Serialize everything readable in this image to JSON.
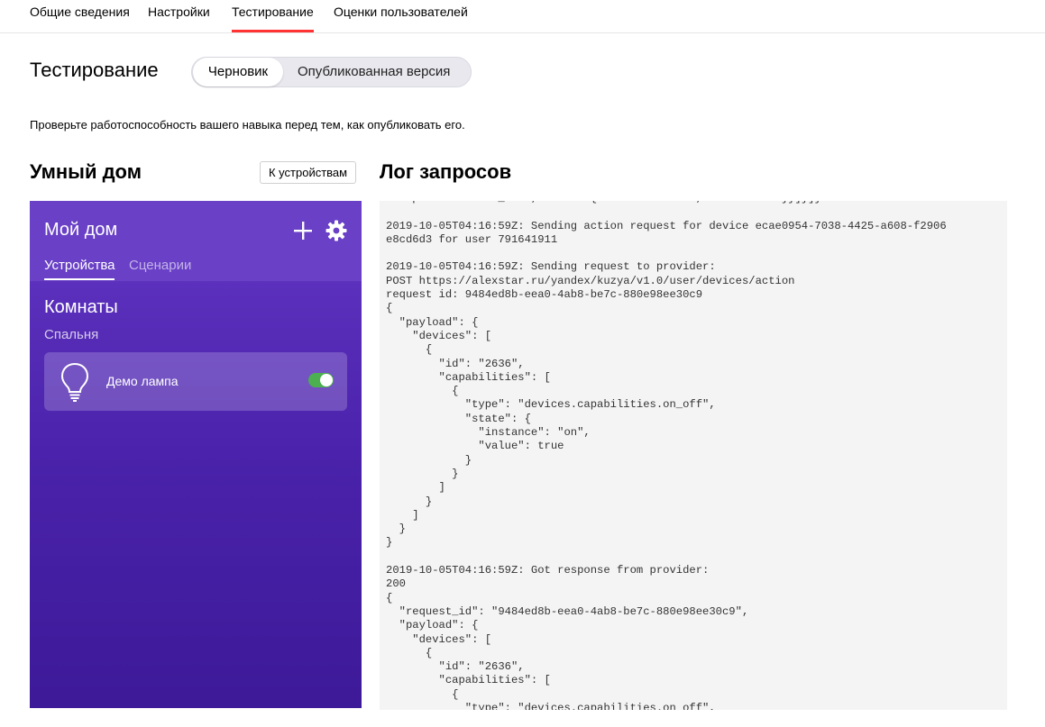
{
  "top_tabs": [
    {
      "label": "Общие сведения"
    },
    {
      "label": "Настройки"
    },
    {
      "label": "Тестирование"
    },
    {
      "label": "Оценки пользователей"
    }
  ],
  "page": {
    "title": "Тестирование",
    "segmented": {
      "draft": "Черновик",
      "published": "Опубликованная версия"
    },
    "description": "Проверьте работоспособность вашего навыка перед тем, как опубликовать его."
  },
  "smart_home": {
    "title": "Умный дом",
    "to_devices_button": "К устройствам",
    "phone": {
      "home_title": "Мой дом",
      "tabs": {
        "devices": "Устройства",
        "scenarios": "Сценарии"
      },
      "rooms_title": "Комнаты",
      "room_name": "Спальня",
      "device": {
        "name": "Демо лампа",
        "state": "on"
      }
    }
  },
  "log": {
    "title": "Лог запросов",
    "text": "s:capabilities.on_off\",\"state\":{\"instance\":\"on\",\"value\":true}}]}]}\n\n2019-10-05T04:16:59Z: Sending action request for device ecae0954-7038-4425-a608-f2906\ne8cd6d3 for user 791641911\n\n2019-10-05T04:16:59Z: Sending request to provider:\nPOST https://alexstar.ru/yandex/kuzya/v1.0/user/devices/action\nrequest id: 9484ed8b-eea0-4ab8-be7c-880e98ee30c9\n{\n  \"payload\": {\n    \"devices\": [\n      {\n        \"id\": \"2636\",\n        \"capabilities\": [\n          {\n            \"type\": \"devices.capabilities.on_off\",\n            \"state\": {\n              \"instance\": \"on\",\n              \"value\": true\n            }\n          }\n        ]\n      }\n    ]\n  }\n}\n\n2019-10-05T04:16:59Z: Got response from provider:\n200\n{\n  \"request_id\": \"9484ed8b-eea0-4ab8-be7c-880e98ee30c9\",\n  \"payload\": {\n    \"devices\": [\n      {\n        \"id\": \"2636\",\n        \"capabilities\": [\n          {\n            \"type\": \"devices.capabilities.on_off\","
  },
  "colors": {
    "accent_red": "#ff3333",
    "phone_purple": "#5a2fbb",
    "toggle_green": "#4caf50"
  }
}
